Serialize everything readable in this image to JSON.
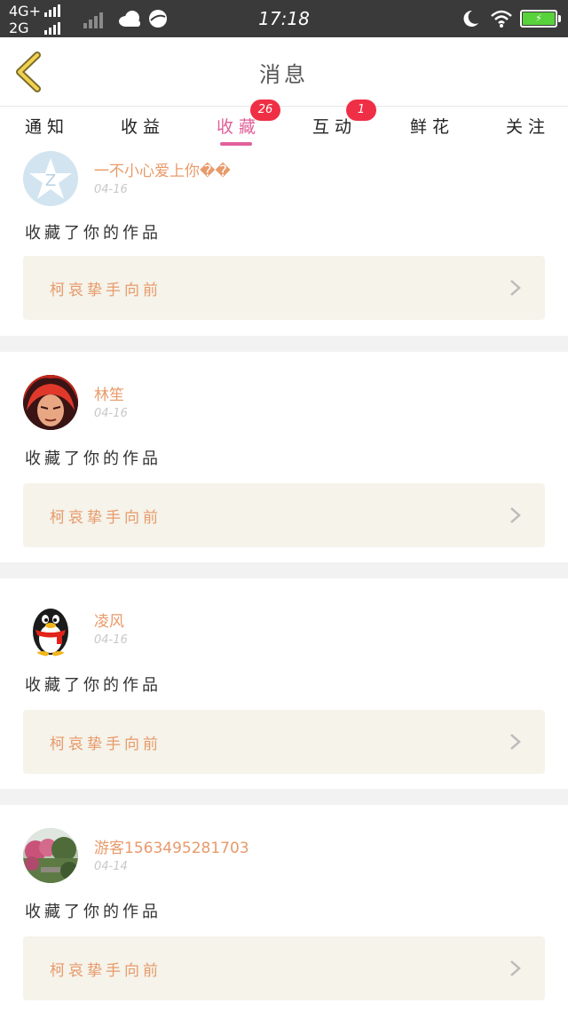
{
  "status_bar": {
    "network_top": "4G+",
    "network_bottom": "2G",
    "time": "17:18",
    "battery_icon": "battery-charging-icon"
  },
  "header": {
    "title": "消息",
    "back_icon": "chevron-left-icon"
  },
  "tabs": [
    {
      "label": "通知",
      "active": false,
      "badge": null
    },
    {
      "label": "收益",
      "active": false,
      "badge": null
    },
    {
      "label": "收藏",
      "active": true,
      "badge": "26"
    },
    {
      "label": "互动",
      "active": false,
      "badge": "1"
    },
    {
      "label": "鲜花",
      "active": false,
      "badge": null
    },
    {
      "label": "关注",
      "active": false,
      "badge": null
    }
  ],
  "messages": [
    {
      "user": "一不小心爱上你��",
      "date": "04-16",
      "action": "收藏了你的作品",
      "work_title": "柯哀挚手向前",
      "avatar": "qzone-default"
    },
    {
      "user": "林笙",
      "date": "04-16",
      "action": "收藏了你的作品",
      "work_title": "柯哀挚手向前",
      "avatar": "red-haired-character"
    },
    {
      "user": "凌风",
      "date": "04-16",
      "action": "收藏了你的作品",
      "work_title": "柯哀挚手向前",
      "avatar": "qq-penguin"
    },
    {
      "user": "游客1563495281703",
      "date": "04-14",
      "action": "收藏了你的作品",
      "work_title": "柯哀挚手向前",
      "avatar": "garden-photo"
    }
  ],
  "colors": {
    "accent": "#e0609a",
    "badge": "#ef2f45",
    "username": "#e89a6a",
    "work_box_bg": "#f5f3ea",
    "status_bar_bg": "#3a3a3a"
  }
}
